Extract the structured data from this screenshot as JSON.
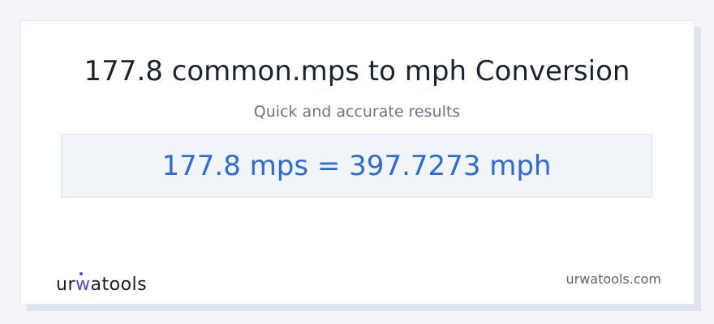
{
  "header": {
    "title": "177.8 common.mps to mph Conversion",
    "subtitle": "Quick and accurate results"
  },
  "result": {
    "text": "177.8 mps = 397.7273 mph"
  },
  "footer": {
    "logo": {
      "part1": "ur",
      "part2": "w",
      "part3": "atools"
    },
    "site_url": "urwatools.com"
  },
  "colors": {
    "result_text": "#2c6bd9",
    "result_background": "#f1f4f9",
    "logo_accent": "#5b45c9",
    "title_text": "#1a2332"
  }
}
